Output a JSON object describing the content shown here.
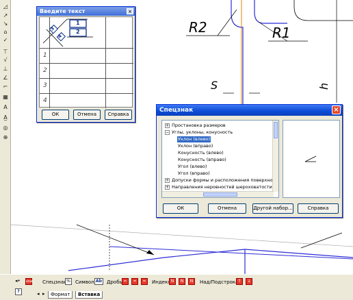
{
  "drawing": {
    "labels": [
      "R2",
      "R1",
      "S",
      "h"
    ]
  },
  "left_toolbar": {
    "icons": [
      "dimension-icon",
      "arrow-icon",
      "leader-icon",
      "pos-icon",
      "mark-icon",
      "base-icon",
      "rough-icon",
      "weld-icon",
      "angle-icon",
      "frame-icon",
      "text-icon",
      "table-icon",
      "sym-icon",
      "axis-icon",
      "dot-icon"
    ]
  },
  "text_dialog": {
    "title": "Введите текст",
    "close_glyph": "×",
    "cell_labels": [
      "3",
      "4",
      "1",
      "2"
    ],
    "row_numbers": [
      "1",
      "2",
      "3",
      "4"
    ],
    "ok_label": "ОК",
    "cancel_label": "Отмена",
    "help_label": "Справка"
  },
  "special_dialog": {
    "title": "Спецзнак",
    "close_glyph": "×",
    "tree": [
      {
        "label": "Простановка размеров",
        "expander": "+",
        "selected": false
      },
      {
        "label": "Углы, уклоны, конусность",
        "expander": "−",
        "selected": false
      },
      {
        "label": "Уклон (влево)",
        "selected": true
      },
      {
        "label": "Уклон (вправо)",
        "selected": false
      },
      {
        "label": "Конусность (влево)",
        "selected": false
      },
      {
        "label": "Конусность (вправо)",
        "selected": false
      },
      {
        "label": "Угол (влево)",
        "selected": false
      },
      {
        "label": "Угол (вправо)",
        "selected": false
      },
      {
        "label": "Допуски формы и расположения поверхностей",
        "expander": "+",
        "selected": false
      },
      {
        "label": "Направления неровностей шероховатости",
        "expander": "+",
        "selected": false
      }
    ],
    "ok_label": "ОК",
    "cancel_label": "Отмена",
    "other_set_label": "Другой набор...",
    "help_label": "Справка"
  },
  "bottom_panel": {
    "spec_label": "Спецзнак",
    "symbol_label": "Символ",
    "symbol_icon_text": "Ab",
    "fraction_label": "Дробь",
    "index_label": "Индекс",
    "index_icon_text": "N",
    "supsub_label": "Над/Подстрока",
    "tabs": [
      "Формат",
      "Вставка"
    ],
    "help_glyph": "?",
    "stop_glyph": "STOP",
    "nav_glyphs": [
      "◂",
      "▸"
    ],
    "pin_glyph": "◂•"
  },
  "colors": {
    "drawing_blue": "#2b2bd6",
    "axis_orange": "#e89a2a",
    "title_blue": "#0a4bd6",
    "selection_blue": "#316ac5"
  }
}
